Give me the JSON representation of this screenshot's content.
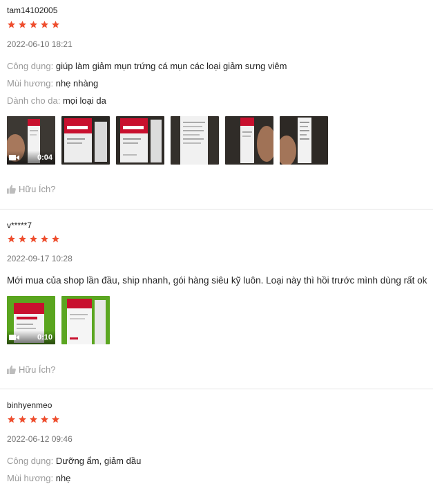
{
  "reviews": [
    {
      "author": "tam14102005",
      "rating": 5,
      "date": "2022-06-10 18:21",
      "attributes": [
        {
          "key": "Công dụng:",
          "value": "giúp làm giảm mụn trứng cá mụn các loại giảm sưng viêm"
        },
        {
          "key": "Mùi hương:",
          "value": "nhẹ nhàng"
        },
        {
          "key": "Dành cho da:",
          "value": "mọi loại da"
        }
      ],
      "video_duration": "0:04",
      "helpful_label": "Hữu Ích?"
    },
    {
      "author": "v*****7",
      "rating": 5,
      "date": "2022-09-17 10:28",
      "comment": "Mới mua của shop lần đầu, ship nhanh, gói hàng siêu kỹ luôn. Loại này thì hồi trước mình dùng rất ok",
      "video_duration": "0:10",
      "helpful_label": "Hữu Ích?"
    },
    {
      "author": "binhyenmeo",
      "rating": 5,
      "date": "2022-06-12 09:46",
      "attributes": [
        {
          "key": "Công dụng:",
          "value": "Dưỡng ẩm, giảm dầu"
        },
        {
          "key": "Mùi hương:",
          "value": "nhẹ"
        }
      ]
    }
  ],
  "colors": {
    "star": "#ee4d2d",
    "muted": "#9a9a9a",
    "brand_red": "#c8102e"
  },
  "icons": {
    "star": "star-icon",
    "thumb_up": "thumbs-up-icon",
    "video": "video-camera-icon"
  }
}
